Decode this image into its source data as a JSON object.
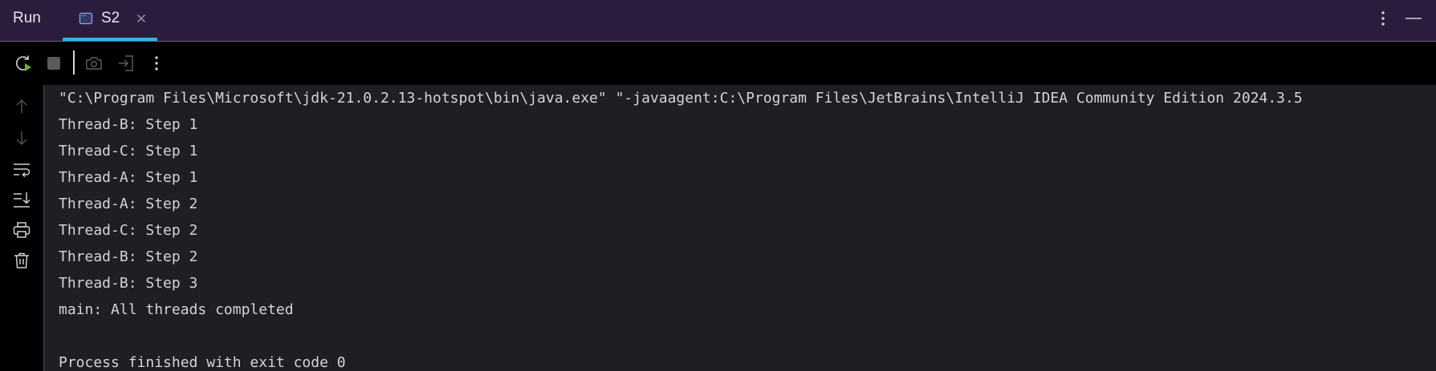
{
  "titlebar": {
    "title": "Run",
    "tabs": [
      {
        "label": "S2",
        "active": true,
        "icon": "console-window-icon"
      }
    ],
    "actions": [
      "more-options-icon",
      "minimize-icon"
    ]
  },
  "toolbar": {
    "buttons": [
      {
        "name": "rerun",
        "icon": "rerun-icon",
        "enabled": true
      },
      {
        "name": "stop",
        "icon": "stop-icon",
        "enabled": false
      },
      {
        "name": "screenshot",
        "icon": "camera-icon",
        "enabled": false
      },
      {
        "name": "restore-layout",
        "icon": "exit-layout-icon",
        "enabled": false
      },
      {
        "name": "more",
        "icon": "kebab-icon",
        "enabled": true
      }
    ]
  },
  "gutter": {
    "buttons": [
      {
        "name": "previous-occurrence",
        "icon": "arrow-up-icon"
      },
      {
        "name": "next-occurrence",
        "icon": "arrow-down-icon"
      },
      {
        "name": "soft-wrap",
        "icon": "soft-wrap-icon"
      },
      {
        "name": "scroll-to-end",
        "icon": "scroll-to-end-icon"
      },
      {
        "name": "print",
        "icon": "print-icon"
      },
      {
        "name": "clear-all",
        "icon": "trash-icon"
      }
    ]
  },
  "console": {
    "lines": [
      "\"C:\\Program Files\\Microsoft\\jdk-21.0.2.13-hotspot\\bin\\java.exe\" \"-javaagent:C:\\Program Files\\JetBrains\\IntelliJ IDEA Community Edition 2024.3.5",
      "Thread-B: Step 1",
      "Thread-C: Step 1",
      "Thread-A: Step 1",
      "Thread-A: Step 2",
      "Thread-C: Step 2",
      "Thread-B: Step 2",
      "Thread-B: Step 3",
      "main: All threads completed",
      "",
      "Process finished with exit code 0"
    ]
  },
  "colors": {
    "titlebar_bg": "#2b1c3e",
    "tab_accent": "#2fb6e0",
    "toolbar_bg": "#000000",
    "console_bg": "#1e1f22",
    "console_text": "#d4d4d4",
    "rerun_badge": "#5fb832"
  }
}
